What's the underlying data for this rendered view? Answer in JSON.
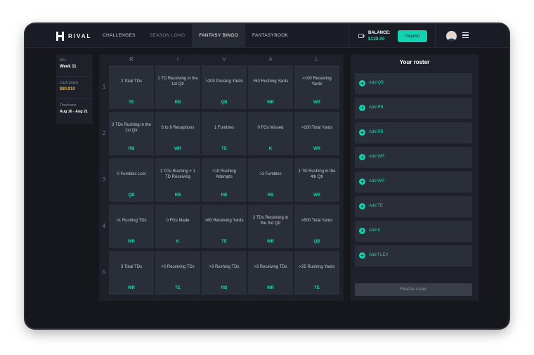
{
  "brand": {
    "name": "RIVAL"
  },
  "nav": {
    "challenges": "CHALLENGES",
    "season_long": "SEASON LONG",
    "fantasy_bingo": "FANTASY BINGO",
    "fantasybook": "FANTASYBOOK",
    "active": "FANTASY BINGO"
  },
  "balance": {
    "label": "BALANCE:",
    "value": "$138.00"
  },
  "deposit_label": "Deposit",
  "info": {
    "league": "NFL",
    "week": "Week 11",
    "cash_label": "Cash prizes",
    "cash_value": "$80,910",
    "timeframe_label": "Timeframe",
    "timeframe_value": "Aug 16 - Aug 21"
  },
  "board": {
    "columns": [
      "R",
      "I",
      "V",
      "A",
      "L"
    ],
    "rows": [
      {
        "num": "1",
        "cells": [
          {
            "text": "2 Total TDs",
            "pos": "TE"
          },
          {
            "text": "1 TD Receiving in the 1st Qtr",
            "pos": "RB"
          },
          {
            "text": ">200 Passing Yards",
            "pos": "QB"
          },
          {
            "text": ">50 Rushing Yards",
            "pos": "WR"
          },
          {
            "text": ">100 Receiving Yards",
            "pos": "WR"
          }
        ]
      },
      {
        "num": "2",
        "cells": [
          {
            "text": "3 TDs Rushing in the 1st Qtr",
            "pos": "RB"
          },
          {
            "text": "6 to 9 Receptions",
            "pos": "WR"
          },
          {
            "text": "1 Fumbles",
            "pos": "TE"
          },
          {
            "text": "0 FGs Missed",
            "pos": "K"
          },
          {
            "text": ">100 Total Yards",
            "pos": "WR"
          }
        ]
      },
      {
        "num": "3",
        "cells": [
          {
            "text": "0 Fumbles Lost",
            "pos": "QB"
          },
          {
            "text": "2 TDs Rushing + 1 TD Receiving",
            "pos": "RB"
          },
          {
            "text": ">10 Rushing Attempts",
            "pos": "RB"
          },
          {
            "text": ">2 Fumbles",
            "pos": "RB"
          },
          {
            "text": "1 TD Rushing in the 4th Qtr",
            "pos": "WR"
          }
        ]
      },
      {
        "num": "4",
        "cells": [
          {
            "text": ">1 Rushing TDs",
            "pos": "WR"
          },
          {
            "text": "0 FGs Made",
            "pos": "K"
          },
          {
            "text": ">80 Receiving Yards",
            "pos": "TE"
          },
          {
            "text": "2 TDs Receiving in the 3rd Qtr",
            "pos": "WR"
          },
          {
            "text": ">500 Total Yards",
            "pos": "QB"
          }
        ]
      },
      {
        "num": "5",
        "cells": [
          {
            "text": "3 Total TDs",
            "pos": "WR"
          },
          {
            "text": ">2 Receiving TDs",
            "pos": "TE"
          },
          {
            "text": ">3 Rushing TDs",
            "pos": "RB"
          },
          {
            "text": ">3 Receiving TDs",
            "pos": "WR"
          },
          {
            "text": ">25 Rushing Yards",
            "pos": "TE"
          }
        ]
      }
    ]
  },
  "roster": {
    "title": "Your roster",
    "slots": [
      "Add QB",
      "Add RB",
      "Add RB",
      "Add WR",
      "Add WR",
      "Add TE",
      "Add K",
      "Add FLEX"
    ],
    "finalize_label": "Finalize roster"
  },
  "colors": {
    "accent": "#12d3b0",
    "gold": "#e9b23a",
    "background": "#15171d",
    "panel": "#1e2129",
    "cell": "#2a2e38"
  },
  "icons": {
    "wallet": "wallet-icon",
    "menu": "hamburger-menu-icon",
    "plus": "plus-circle-icon"
  }
}
